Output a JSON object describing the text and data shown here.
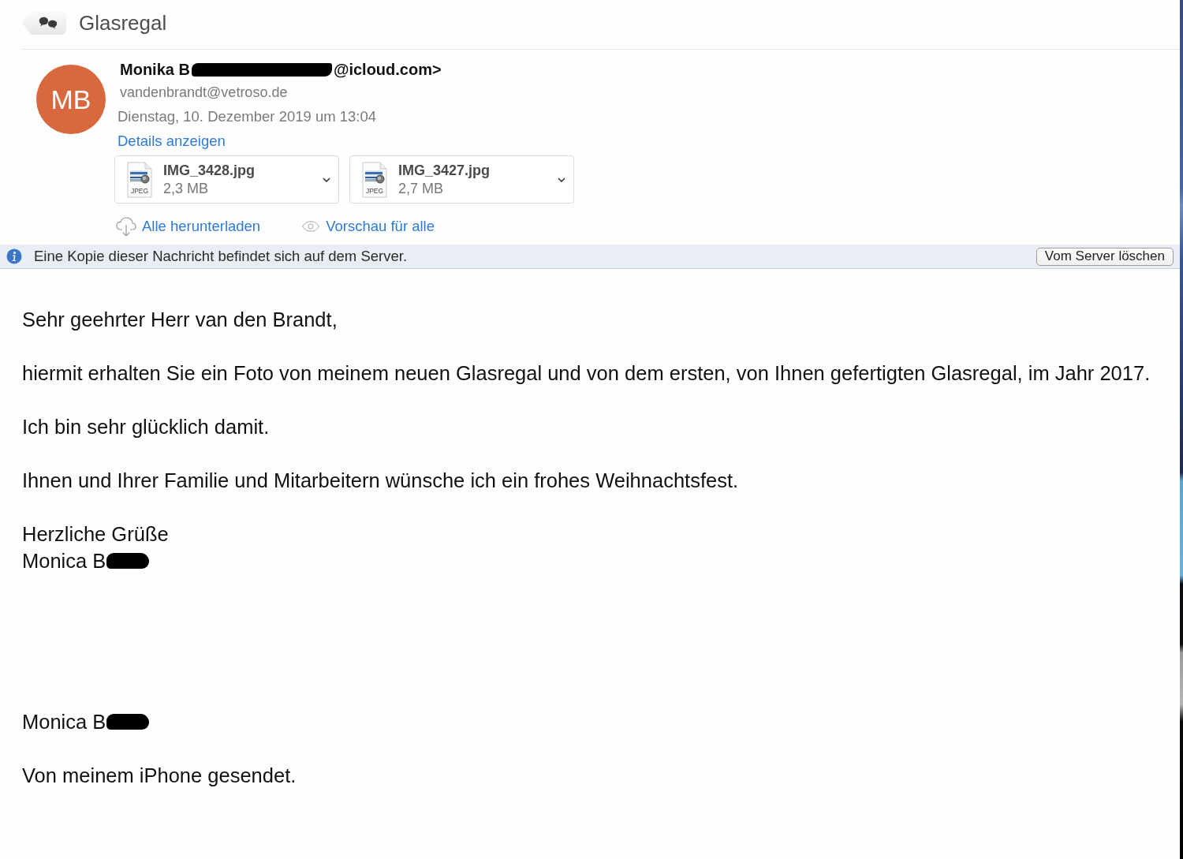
{
  "thread": {
    "title": "Glasregal"
  },
  "message": {
    "avatar": {
      "initials": "MB"
    },
    "sender": {
      "name_start": "Monika B",
      "redacted": true,
      "address_end": "@icloud.com>"
    },
    "recipient": "vandenbrandt@vetroso.de",
    "date": "Dienstag, 10. Dezember 2019 um 13:04",
    "details_link": "Details anzeigen",
    "attachments": [
      {
        "name": "IMG_3428.jpg",
        "size": "2,3 MB",
        "file_type": "JPEG"
      },
      {
        "name": "IMG_3427.jpg",
        "size": "2,7 MB",
        "file_type": "JPEG"
      }
    ],
    "actions": [
      {
        "kind": "download",
        "label": "Alle herunterladen"
      },
      {
        "kind": "preview",
        "label": "Vorschau für alle"
      }
    ]
  },
  "server_notice": {
    "text": "Eine Kopie dieser Nachricht befindet sich auf dem Server.",
    "button": "Vom Server löschen"
  },
  "body": {
    "blocks": [
      {
        "kind": "paragraph",
        "lines": [
          {
            "text": "Sehr geehrter Herr van den Brandt,",
            "redacted": false
          }
        ]
      },
      {
        "kind": "paragraph",
        "lines": [
          {
            "text": "hiermit erhalten Sie ein Foto von meinem neuen Glasregal und von dem ersten, von Ihnen gefertigten Glasregal, im Jahr 2017.",
            "redacted": false
          }
        ]
      },
      {
        "kind": "paragraph",
        "lines": [
          {
            "text": "Ich bin sehr glücklich damit.",
            "redacted": false
          }
        ]
      },
      {
        "kind": "paragraph",
        "lines": [
          {
            "text": "Ihnen und Ihrer Familie und Mitarbeitern wünsche ich ein frohes Weihnachtsfest.",
            "redacted": false
          }
        ]
      },
      {
        "kind": "paragraph",
        "lines": [
          {
            "text": "Herzliche Grüße",
            "redacted": false
          },
          {
            "text": "Monica B",
            "redacted": true
          }
        ]
      },
      {
        "kind": "signature",
        "lines": [
          {
            "text": "Monica B",
            "redacted": true
          }
        ]
      },
      {
        "kind": "paragraph",
        "lines": [
          {
            "text": "Von meinem iPhone gesendet.",
            "redacted": false
          }
        ]
      }
    ]
  }
}
